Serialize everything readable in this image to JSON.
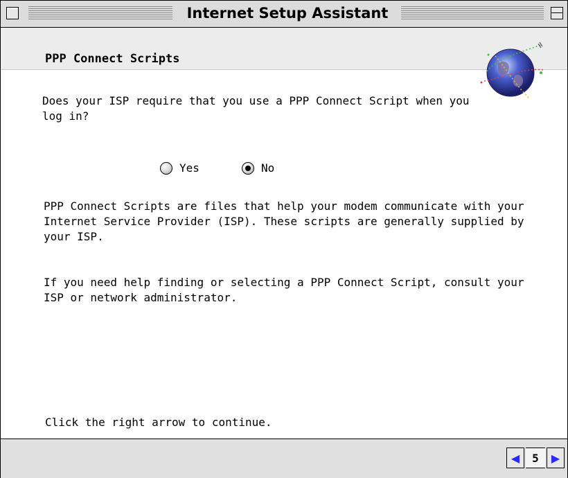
{
  "window": {
    "title": "Internet Setup Assistant"
  },
  "header": {
    "page_title": "PPP Connect Scripts"
  },
  "content": {
    "question": "Does your ISP require that you use a PPP Connect Script when you log in?",
    "options": [
      {
        "label": "Yes",
        "selected": false
      },
      {
        "label": "No",
        "selected": true
      }
    ],
    "paragraph1": "PPP Connect Scripts are files that help your modem communicate with your Internet Service Provider (ISP).  These scripts are generally supplied by your ISP.",
    "paragraph2": "If you need help finding or selecting a PPP Connect Script, consult your ISP or network administrator.",
    "footer_text": "Click the right arrow to continue."
  },
  "navigation": {
    "page_number": "5",
    "prev_icon": "left-arrow-icon",
    "next_icon": "right-arrow-icon"
  },
  "icons": {
    "globe": "globe-icon"
  },
  "colors": {
    "arrow": "#2a2aff",
    "titlebar": "#dcdcdc"
  }
}
